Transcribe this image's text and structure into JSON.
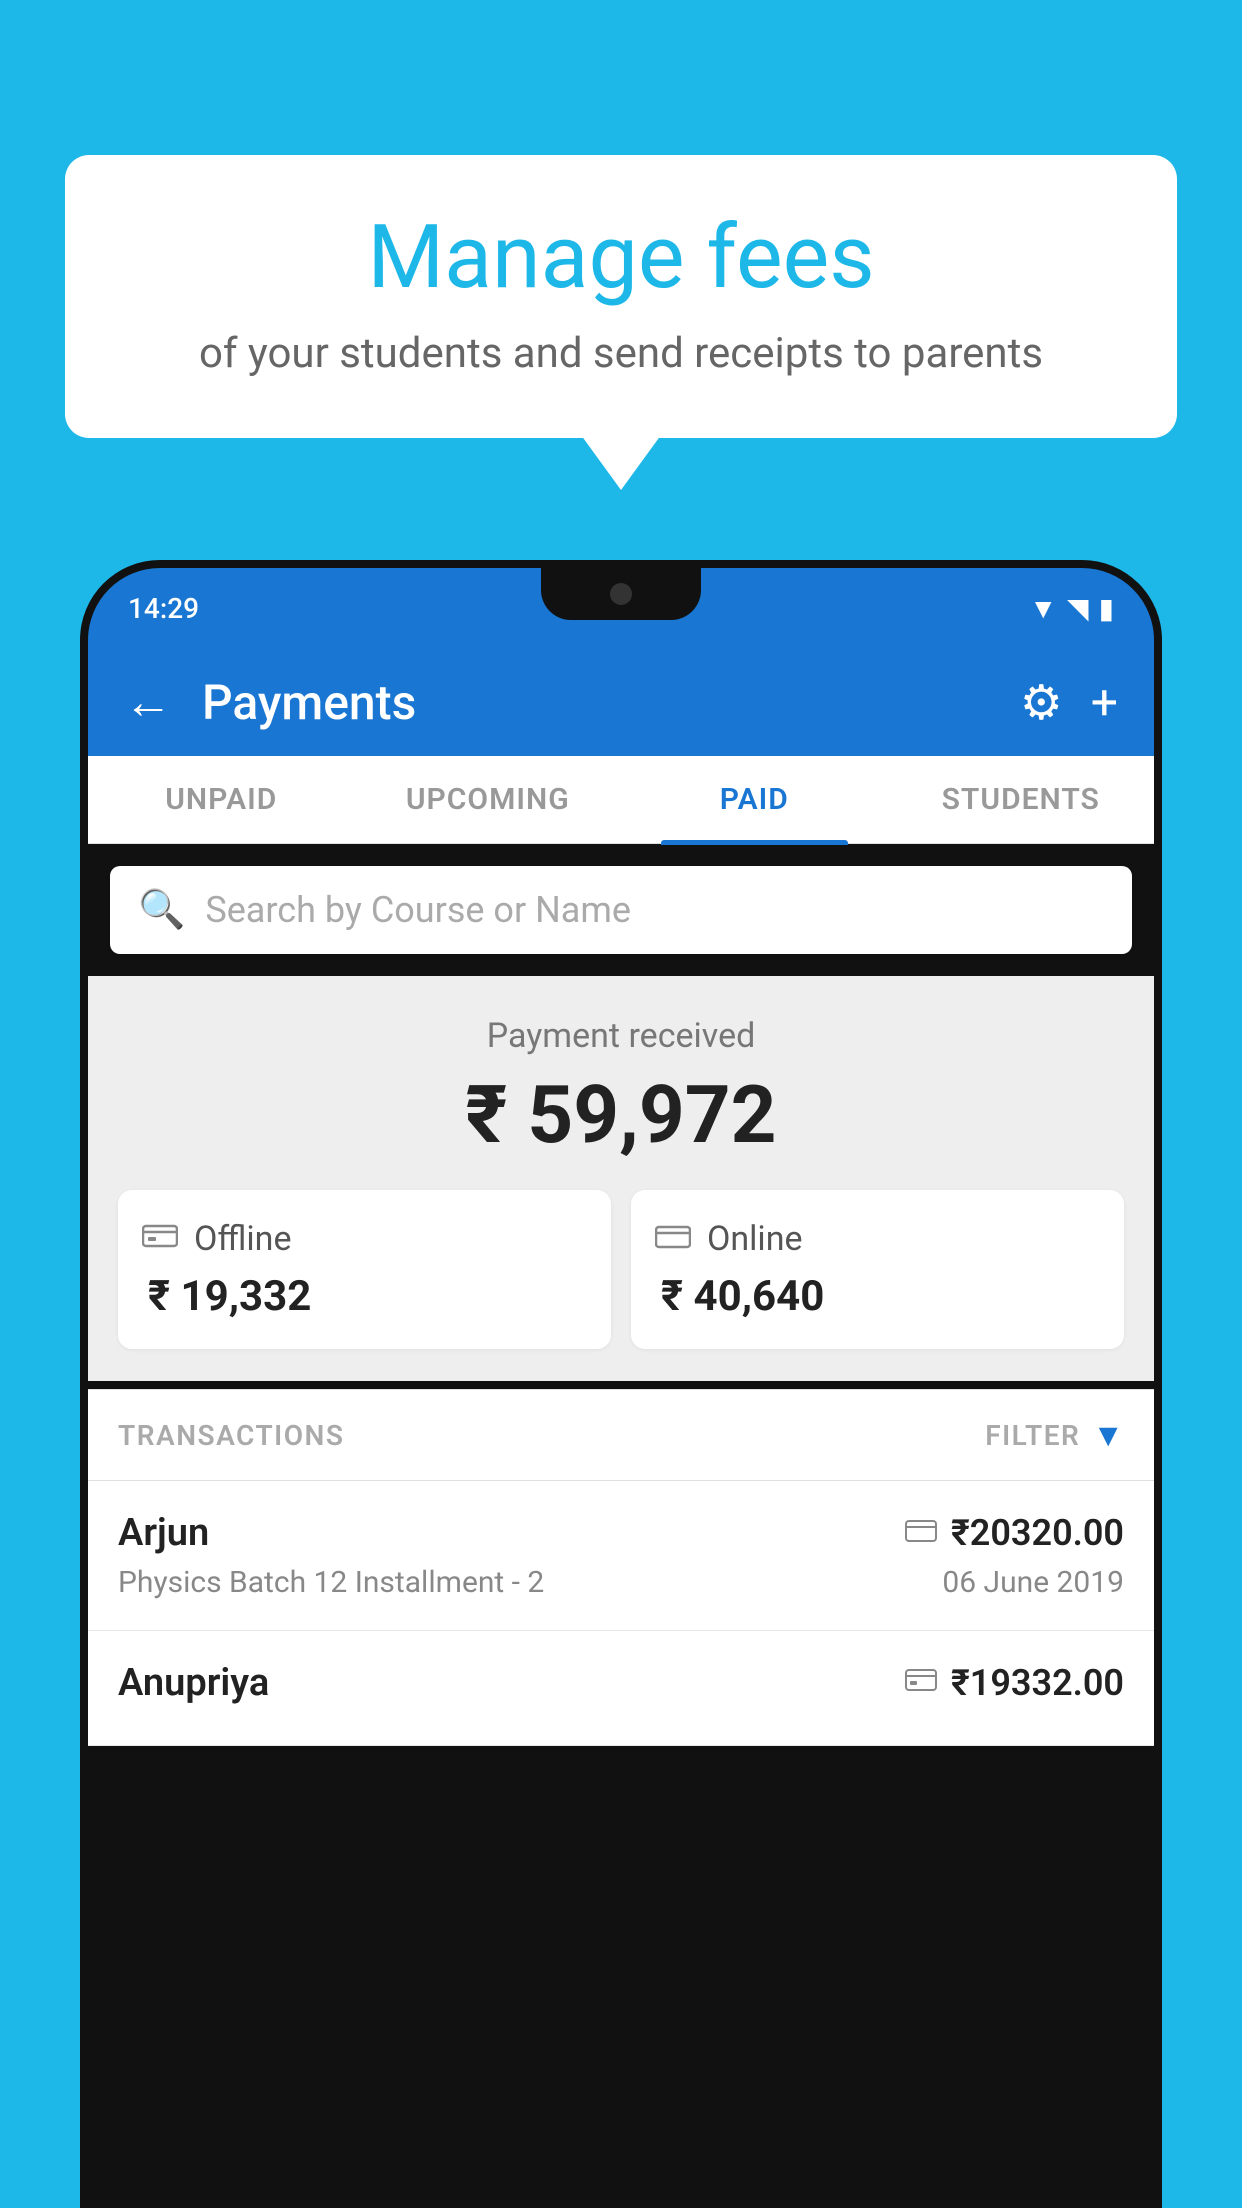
{
  "background_color": "#1DB8E8",
  "bubble": {
    "title": "Manage fees",
    "subtitle": "of your students and send receipts to parents"
  },
  "phone": {
    "status_bar": {
      "time": "14:29",
      "wifi": "▲",
      "signal": "▲",
      "battery": "▮"
    },
    "header": {
      "back_label": "←",
      "title": "Payments",
      "gear_label": "⚙",
      "plus_label": "+"
    },
    "tabs": [
      {
        "label": "UNPAID",
        "active": false
      },
      {
        "label": "UPCOMING",
        "active": false
      },
      {
        "label": "PAID",
        "active": true
      },
      {
        "label": "STUDENTS",
        "active": false
      }
    ],
    "search": {
      "placeholder": "Search by Course or Name"
    },
    "payment_received": {
      "label": "Payment received",
      "amount": "₹ 59,972",
      "offline": {
        "label": "Offline",
        "amount": "₹ 19,332"
      },
      "online": {
        "label": "Online",
        "amount": "₹ 40,640"
      }
    },
    "transactions": {
      "header_label": "TRANSACTIONS",
      "filter_label": "FILTER",
      "items": [
        {
          "name": "Arjun",
          "course": "Physics Batch 12 Installment - 2",
          "amount": "₹20320.00",
          "date": "06 June 2019",
          "icon_type": "card"
        },
        {
          "name": "Anupriya",
          "course": "",
          "amount": "₹19332.00",
          "date": "",
          "icon_type": "cash"
        }
      ]
    }
  }
}
